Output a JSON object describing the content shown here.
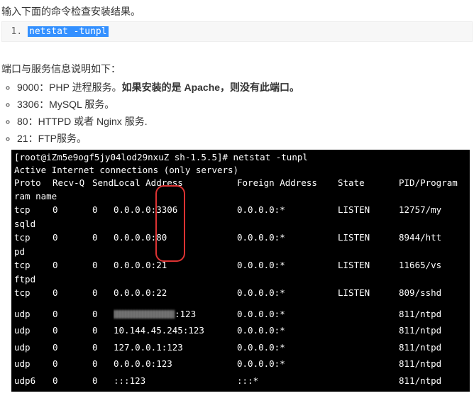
{
  "intro": "输入下面的命令检查安装结果。",
  "code": {
    "cmd": "netstat -tunpl"
  },
  "section_title": "端口与服务信息说明如下：",
  "ports": [
    {
      "port": "9000",
      "desc": "：PHP 进程服务。",
      "strong": "如果安装的是 Apache，则没有此端口。"
    },
    {
      "port": "3306",
      "desc": "：MySQL 服务。",
      "strong": ""
    },
    {
      "port": "80",
      "desc": "：HTTPD 或者 Nginx 服务.",
      "strong": ""
    },
    {
      "port": "21",
      "desc": "：FTP服务。",
      "strong": ""
    }
  ],
  "terminal": {
    "prompt": "[root@iZm5e9ogf5jy04lod29nxuZ sh-1.5.5]# netstat -tunpl",
    "line2": "Active Internet connections (only servers)",
    "headers": {
      "proto": "Proto",
      "recvq": "Recv-Q",
      "sendq": "Send-Q",
      "local": "Local Address",
      "foreign": "Foreign Address",
      "state": "State",
      "pid": "PID/Program name"
    },
    "rows": [
      {
        "proto": "tcp",
        "wrap": "sqld",
        "recvq": "0",
        "sendq": "0",
        "local_pre": "0.0.0.0:",
        "local_port": "3306",
        "foreign": "0.0.0.0:*",
        "state": "LISTEN",
        "pid": "12757/my"
      },
      {
        "proto": "tcp",
        "wrap": "pd",
        "recvq": "0",
        "sendq": "0",
        "local_pre": "0.0.0.0:",
        "local_port": "80",
        "foreign": "0.0.0.0:*",
        "state": "LISTEN",
        "pid": "8944/htt"
      },
      {
        "proto": "tcp",
        "wrap": "ftpd",
        "recvq": "0",
        "sendq": "0",
        "local_pre": "0.0.0.0:",
        "local_port": "21",
        "foreign": "0.0.0.0:*",
        "state": "LISTEN",
        "pid": "11665/vs"
      },
      {
        "proto": "tcp",
        "wrap": "",
        "recvq": "0",
        "sendq": "0",
        "local_pre": "0.0.0.0:",
        "local_port": "22",
        "foreign": "0.0.0.0:*",
        "state": "LISTEN",
        "pid": "809/sshd"
      },
      {
        "gap": true
      },
      {
        "proto": "udp",
        "wrap": "",
        "recvq": "0",
        "sendq": "0",
        "local_raw_blur": true,
        "local_port": ":123",
        "foreign": "0.0.0.0:*",
        "state": "",
        "pid": "811/ntpd"
      },
      {
        "gap_sm": true
      },
      {
        "proto": "udp",
        "wrap": "",
        "recvq": "0",
        "sendq": "0",
        "local_raw": "10.144.45.245:123",
        "foreign": "0.0.0.0:*",
        "state": "",
        "pid": "811/ntpd"
      },
      {
        "gap_sm": true
      },
      {
        "proto": "udp",
        "wrap": "",
        "recvq": "0",
        "sendq": "0",
        "local_raw": "127.0.0.1:123",
        "foreign": "0.0.0.0:*",
        "state": "",
        "pid": "811/ntpd"
      },
      {
        "gap_sm": true
      },
      {
        "proto": "udp",
        "wrap": "",
        "recvq": "0",
        "sendq": "0",
        "local_raw": "0.0.0.0:123",
        "foreign": "0.0.0.0:*",
        "state": "",
        "pid": "811/ntpd"
      },
      {
        "gap_sm": true
      },
      {
        "proto": "udp6",
        "wrap": "",
        "recvq": "0",
        "sendq": "0",
        "local_raw": ":::123",
        "foreign": ":::*",
        "state": "",
        "pid": "811/ntpd"
      }
    ]
  }
}
